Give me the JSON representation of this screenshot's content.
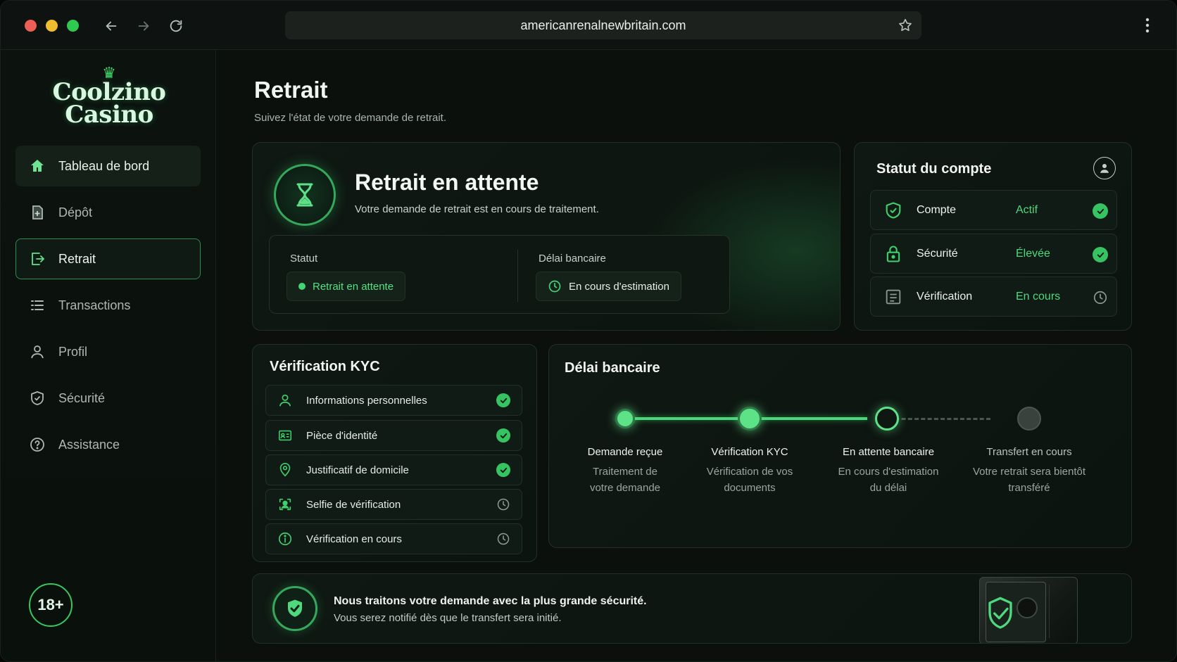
{
  "browser": {
    "url": "americanrenalnewbritain.com"
  },
  "brand": {
    "line1": "Coolzino",
    "line2": "Casino",
    "crown": "♛"
  },
  "sidebar": {
    "items": [
      {
        "label": "Tableau de bord",
        "icon": "home-icon"
      },
      {
        "label": "Dépôt",
        "icon": "deposit-icon"
      },
      {
        "label": "Retrait",
        "icon": "withdraw-icon"
      },
      {
        "label": "Transactions",
        "icon": "list-icon"
      },
      {
        "label": "Profil",
        "icon": "user-icon"
      },
      {
        "label": "Sécurité",
        "icon": "shield-icon"
      },
      {
        "label": "Assistance",
        "icon": "help-icon"
      }
    ],
    "age_badge": "18+"
  },
  "page": {
    "title": "Retrait",
    "subtitle": "Suivez l'état de votre demande de retrait."
  },
  "pending": {
    "title": "Retrait en attente",
    "subtitle": "Votre demande de retrait est en cours de traitement.",
    "status_label": "Statut",
    "status_value": "Retrait en attente",
    "delay_label": "Délai bancaire",
    "delay_value": "En cours d'estimation"
  },
  "account": {
    "title": "Statut du compte",
    "rows": [
      {
        "name": "Compte",
        "value": "Actif",
        "state": "done"
      },
      {
        "name": "Sécurité",
        "value": "Élevée",
        "state": "done"
      },
      {
        "name": "Vérification",
        "value": "En cours",
        "state": "pending"
      }
    ]
  },
  "kyc": {
    "title": "Vérification KYC",
    "rows": [
      {
        "label": "Informations personnelles",
        "state": "done"
      },
      {
        "label": "Pièce d'identité",
        "state": "done"
      },
      {
        "label": "Justificatif de domicile",
        "state": "done"
      },
      {
        "label": "Selfie de vérification",
        "state": "pending"
      },
      {
        "label": "Vérification en cours",
        "state": "pending"
      }
    ]
  },
  "delay": {
    "title": "Délai bancaire",
    "steps": [
      {
        "title": "Demande reçue",
        "line1": "Traitement de",
        "line2": "votre demande"
      },
      {
        "title": "Vérification KYC",
        "line1": "Vérification de vos",
        "line2": "documents"
      },
      {
        "title": "En attente bancaire",
        "line1": "En cours d'estimation",
        "line2": "du délai"
      },
      {
        "title": "Transfert en cours",
        "line1": "Votre retrait sera bientôt",
        "line2": "transféré"
      }
    ]
  },
  "security_notice": {
    "line1": "Nous traitons votre demande avec la plus grande sécurité.",
    "line2": "Vous serez notifié dès que le transfert sera initié."
  },
  "colors": {
    "accent": "#48d877",
    "background": "#0b100d",
    "card": "#0f1813",
    "muted": "#9ba69f"
  }
}
